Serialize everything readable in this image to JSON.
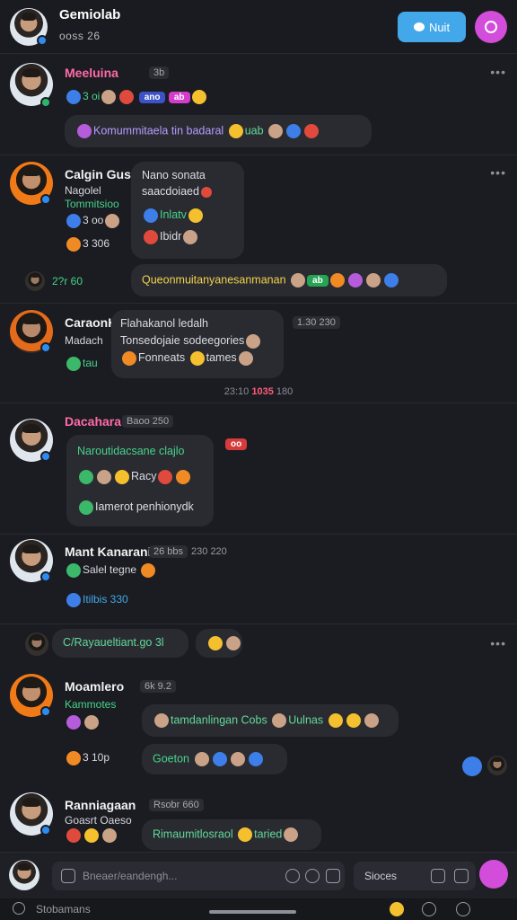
{
  "header": {
    "title": "Gemiolab",
    "subtitle": "ooss 26",
    "call_label": "Nuit"
  },
  "messages": [
    {
      "name": "Meeluina",
      "meta": "3b",
      "line1": "3 oi",
      "tags": [
        "ano",
        "ab"
      ],
      "bubble": "Komummitaela tin badaral",
      "bubble_tail": "uab"
    },
    {
      "name": "Calgin Gusaan",
      "sub1": "Nagolel",
      "sub2": "Tommitsioo",
      "meta_line": "3 oo",
      "bubble_head": "Nano sonata",
      "bubble_l1": "saacdoiaed",
      "bubble_l2": "Inlatv",
      "bubble_l3": "Ibidr",
      "side_text": "3 306",
      "wide_bubble_prefix": "2?r 60",
      "wide_bubble": "Queonmuitanyanesanmanan",
      "wide_tag": "ab"
    },
    {
      "name": "CaraonKafanne",
      "meta": "1.30 230",
      "sub": "Madach",
      "bubble_l1": "Flahakanol ledalh",
      "bubble_l2": "Tonsedojaie sodeegories",
      "bubble_l3": "Fonneats",
      "bubble_tail": "tames",
      "side": "tau"
    },
    {
      "date_left": "23:10",
      "date_mid": "1035",
      "date_right": "180"
    },
    {
      "name": "Dacahara",
      "meta": "Baoo 250",
      "bubble_l1": "Naroutidacsane clajlo",
      "bubble_l2": "Racy",
      "bubble_l3": "Iamerot penhionydk"
    },
    {
      "name": "Mant Kanarani",
      "meta1": "26 bbs",
      "meta2": "230 220",
      "sub": "Salel tegne",
      "link": "Itilbis 330"
    },
    {
      "bubble": "C/Rayaueltiant.go 3l"
    },
    {
      "name": "Moamlero",
      "meta": "6k 9.2",
      "sub": "Kammotes",
      "bubble1": "tamdanlingan Cobs",
      "bubble1_tail": "Uulnas",
      "side_text": "3 10p",
      "bubble2": "Goeton"
    },
    {
      "name": "Ranniagaan",
      "meta": "Rsobr 660",
      "sub": "Goasrt Oaeso",
      "bubble": "Rimaumitlosraol",
      "bubble_tail": "taried"
    }
  ],
  "composer": {
    "placeholder": "Bneaer/eandengh...",
    "sticker_label": "Sioces"
  },
  "navbar": {
    "label": "Stobamans"
  },
  "colors": {
    "accent_blue": "#43a8ea",
    "accent_magenta": "#d24dd9",
    "background": "#1b1c21"
  }
}
